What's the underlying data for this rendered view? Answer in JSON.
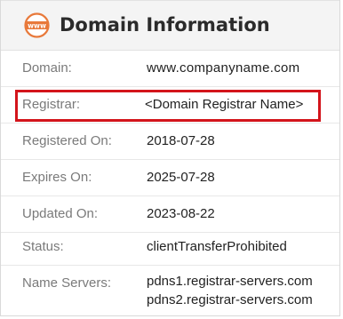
{
  "header": {
    "title": "Domain Information",
    "icon": "www-globe-icon",
    "icon_text": "www",
    "icon_color": "#e8793a"
  },
  "rows": [
    {
      "label": "Domain:",
      "value": "www.companyname.com"
    },
    {
      "label": "Registrar:",
      "value": "<Domain Registrar Name>"
    },
    {
      "label": "Registered On:",
      "value": "2018-07-28"
    },
    {
      "label": "Expires On:",
      "value": "2025-07-28"
    },
    {
      "label": "Updated On:",
      "value": "2023-08-22"
    },
    {
      "label": "Status:",
      "value": "clientTransferProhibited"
    },
    {
      "label": "Name Servers:",
      "value_lines": [
        "pdns1.registrar-servers.com",
        "pdns2.registrar-servers.com"
      ]
    }
  ],
  "highlight_color": "#d3141b"
}
